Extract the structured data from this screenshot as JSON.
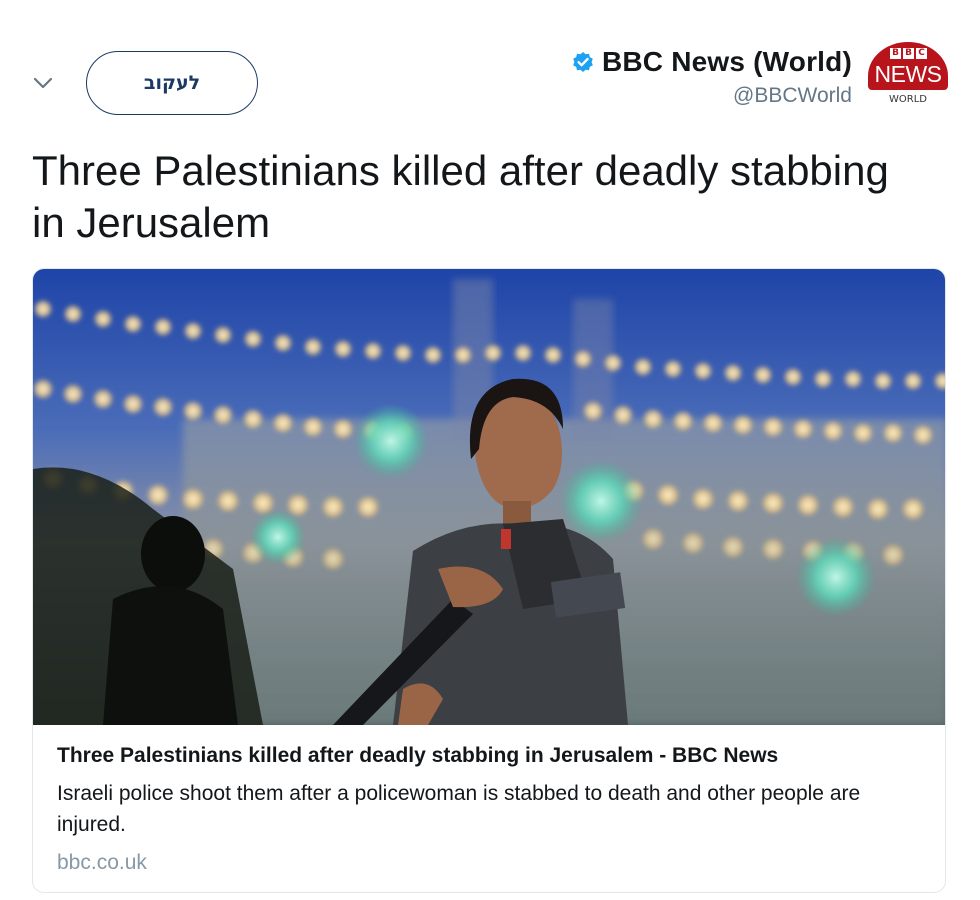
{
  "header": {
    "follow_label": "לעקוב",
    "account_name": "BBC News (World)",
    "account_handle": "@BBCWorld",
    "avatar": {
      "bbc_letters": [
        "B",
        "B",
        "C"
      ],
      "news": "NEWS",
      "world": "WORLD"
    }
  },
  "tweet": {
    "text": "Three Palestinians killed after deadly stabbing in Jerusalem"
  },
  "card": {
    "title": "Three Palestinians killed after deadly stabbing in Jerusalem - BBC News",
    "description": "Israeli police shoot them after a policewoman is stabbed to death and other people are injured.",
    "domain": "bbc.co.uk"
  },
  "colors": {
    "accent": "#1da1f2",
    "follow_border": "#1b3a63",
    "bbc_red": "#b8141c",
    "muted_text": "#657786",
    "domain_text": "#8899a6"
  },
  "icons": {
    "chevron": "chevron-down-icon",
    "verified": "verified-badge-icon"
  }
}
